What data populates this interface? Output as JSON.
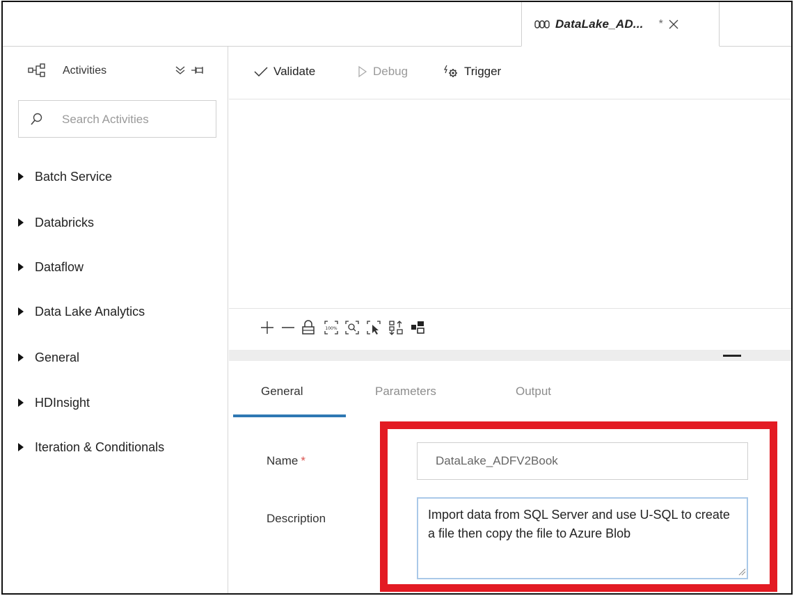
{
  "tab": {
    "title": "DataLake_AD...",
    "dirty_marker": "*",
    "icon": "pipeline-icon"
  },
  "sidebar": {
    "header_label": "Activities",
    "search_placeholder": "Search Activities",
    "categories": [
      {
        "label": "Batch Service"
      },
      {
        "label": "Databricks"
      },
      {
        "label": "Dataflow"
      },
      {
        "label": "Data Lake Analytics"
      },
      {
        "label": "General"
      },
      {
        "label": "HDInsight"
      },
      {
        "label": "Iteration & Conditionals"
      }
    ]
  },
  "toolbar": {
    "validate_label": "Validate",
    "debug_label": "Debug",
    "trigger_label": "Trigger"
  },
  "zoom_controls": [
    "zoom-in-icon",
    "zoom-out-icon",
    "lock-icon",
    "zoom-100-icon",
    "zoom-to-fit-icon",
    "select-icon",
    "auto-align-icon",
    "layout-icon"
  ],
  "properties": {
    "tabs": [
      {
        "label": "General",
        "active": true
      },
      {
        "label": "Parameters",
        "active": false
      },
      {
        "label": "Output",
        "active": false
      }
    ],
    "name_label": "Name",
    "required_marker": "*",
    "name_value": "DataLake_ADFV2Book",
    "description_label": "Description",
    "description_value": "Import data from SQL Server and use U-SQL to create a file then copy the file to Azure Blob"
  },
  "colors": {
    "accent": "#2f78b3",
    "highlight": "#e31b23",
    "required": "#d9534f"
  }
}
